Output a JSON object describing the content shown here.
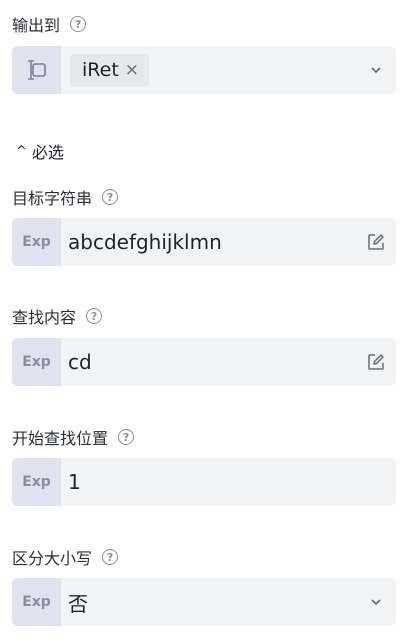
{
  "output": {
    "label": "输出到",
    "help": "?",
    "tag": "iRet",
    "tag_close": "×"
  },
  "section": {
    "caret": "^",
    "label": "必选"
  },
  "fields": [
    {
      "label": "目标字符串",
      "help": "?",
      "prefix": "Exp",
      "value": "abcdefghijklmn",
      "action_icon": "edit-icon"
    },
    {
      "label": "查找内容",
      "help": "?",
      "prefix": "Exp",
      "value": "cd",
      "action_icon": "edit-icon"
    },
    {
      "label": "开始查找位置",
      "help": "?",
      "prefix": "Exp",
      "value": "1"
    },
    {
      "label": "区分大小写",
      "help": "?",
      "prefix": "Exp",
      "value": "否",
      "action_icon": "chevron-down-icon"
    }
  ],
  "colors": {
    "field_bg": "#f2f3f5",
    "prefix_bg": "#e0e2ef",
    "prefix_text": "#8a8fa3",
    "icon": "#646a73"
  }
}
